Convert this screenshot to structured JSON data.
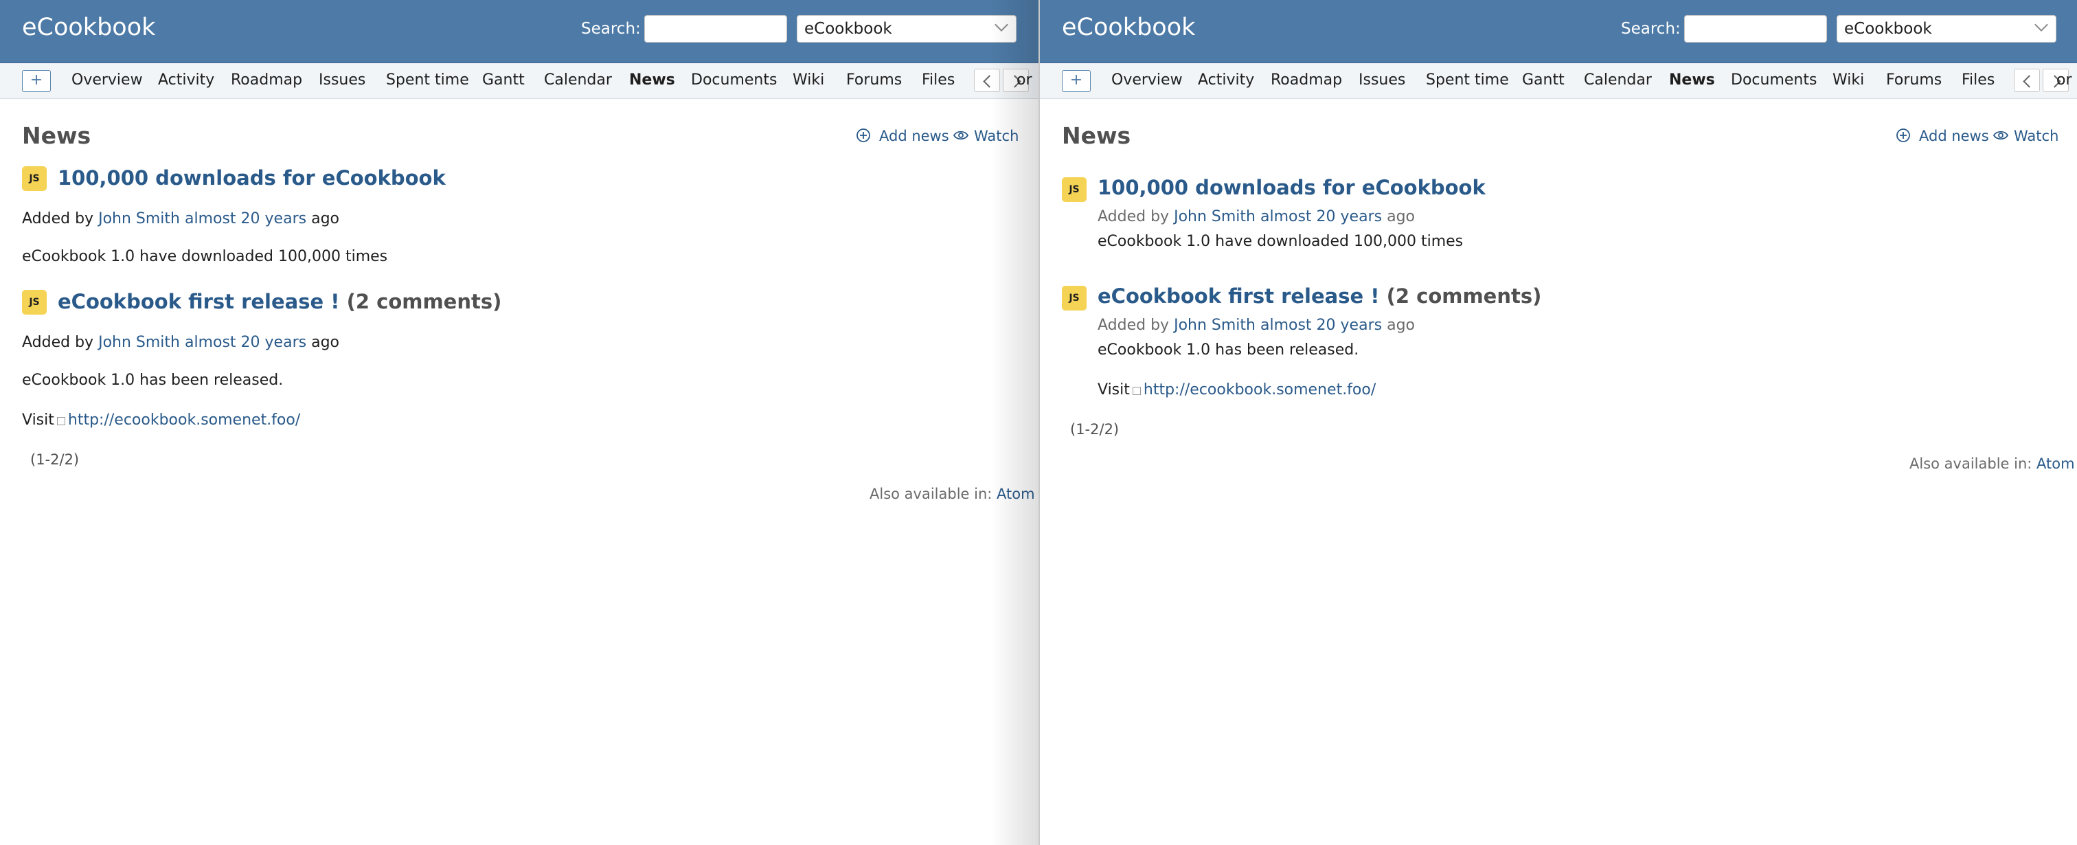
{
  "header": {
    "title": "eCookbook",
    "search_label": "Search:",
    "search_value": "",
    "project_select_value": "eCookbook"
  },
  "tabs": {
    "plus_label": "+",
    "items": [
      {
        "label": "Overview"
      },
      {
        "label": "Activity"
      },
      {
        "label": "Roadmap"
      },
      {
        "label": "Issues"
      },
      {
        "label": "Spent time"
      },
      {
        "label": "Gantt"
      },
      {
        "label": "Calendar"
      },
      {
        "label": "News",
        "selected": true
      },
      {
        "label": "Documents"
      },
      {
        "label": "Wiki"
      },
      {
        "label": "Forums"
      },
      {
        "label": "Files"
      }
    ],
    "overflow_text": "or"
  },
  "content": {
    "title": "News",
    "add_news_label": "Add news",
    "watch_label": "Watch",
    "news": [
      {
        "avatar": "JS",
        "title": "100,000 downloads for eCookbook",
        "comments": "",
        "added_by": "Added by",
        "author": "John Smith",
        "when": "almost 20 years",
        "ago": "ago",
        "summary": "eCookbook 1.0 have downloaded 100,000 times"
      },
      {
        "avatar": "JS",
        "title": "eCookbook first release !",
        "comments": "(2 comments)",
        "added_by": "Added by",
        "author": "John Smith",
        "when": "almost 20 years",
        "ago": "ago",
        "summary": "eCookbook 1.0 has been released.",
        "visit_label": "Visit",
        "visit_url": "http://ecookbook.somenet.foo/"
      }
    ],
    "pagination": "(1-2/2)",
    "also_available": "Also available in:",
    "atom_label": "Atom"
  }
}
